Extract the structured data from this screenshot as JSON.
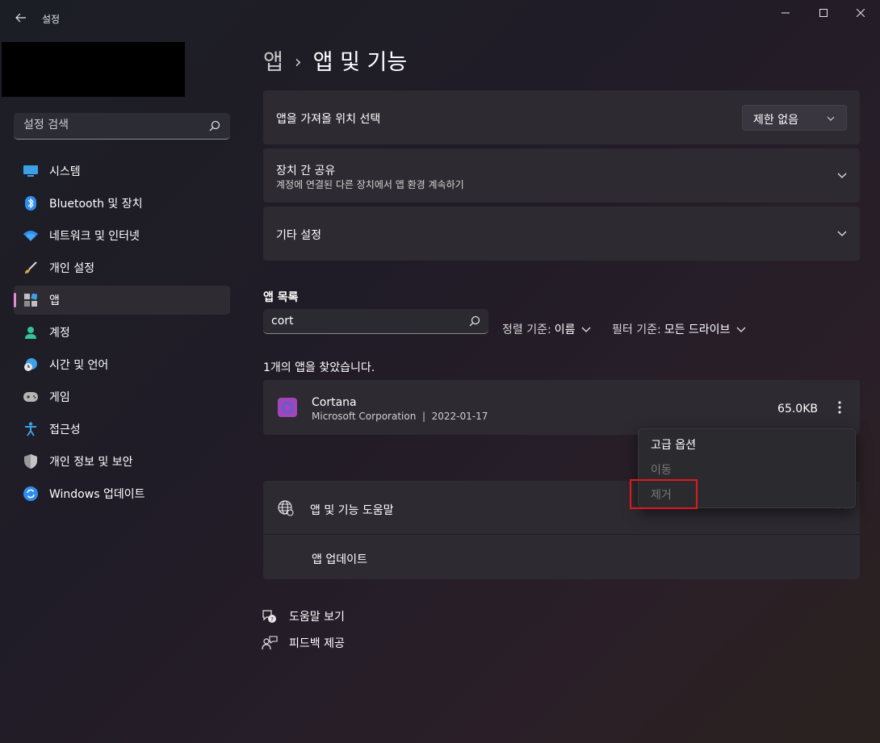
{
  "window": {
    "title": "설정",
    "minimize_icon": "minimize-icon",
    "maximize_icon": "maximize-icon",
    "close_icon": "close-icon"
  },
  "sidebar": {
    "search_placeholder": "설정 검색",
    "items": [
      {
        "label": "시스템",
        "icon": "system-icon"
      },
      {
        "label": "Bluetooth 및 장치",
        "icon": "bluetooth-icon"
      },
      {
        "label": "네트워크 및 인터넷",
        "icon": "wifi-icon"
      },
      {
        "label": "개인 설정",
        "icon": "brush-icon"
      },
      {
        "label": "앱",
        "icon": "apps-icon",
        "active": true
      },
      {
        "label": "계정",
        "icon": "account-icon"
      },
      {
        "label": "시간 및 언어",
        "icon": "clock-globe-icon"
      },
      {
        "label": "게임",
        "icon": "gamepad-icon"
      },
      {
        "label": "접근성",
        "icon": "accessibility-icon"
      },
      {
        "label": "개인 정보 및 보안",
        "icon": "shield-icon"
      },
      {
        "label": "Windows 업데이트",
        "icon": "update-icon"
      }
    ]
  },
  "breadcrumb": {
    "parent": "앱",
    "separator": "›",
    "current": "앱 및 기능"
  },
  "settings": {
    "install_source": {
      "label": "앱을 가져올 위치 선택",
      "value": "제한 없음"
    },
    "share_across": {
      "label": "장치 간 공유",
      "sub": "계정에 연결된 다른 장치에서 앱 환경 계속하기"
    },
    "more_settings": {
      "label": "기타 설정"
    }
  },
  "app_list": {
    "heading": "앱 목록",
    "search_value": "cort",
    "sort_label": "정렬 기준:",
    "sort_value": "이름",
    "filter_label": "필터 기준:",
    "filter_value": "모든 드라이브",
    "found_text": "1개의 앱을 찾았습니다.",
    "apps": [
      {
        "name": "Cortana",
        "publisher": "Microsoft Corporation",
        "separator": "|",
        "date": "2022-01-17",
        "size": "65.0KB"
      }
    ]
  },
  "context_menu": {
    "items": [
      {
        "label": "고급 옵션",
        "enabled": true
      },
      {
        "label": "이동",
        "enabled": false
      },
      {
        "label": "제거",
        "enabled": false
      }
    ],
    "highlight_color": "#e0191e"
  },
  "help": {
    "title": "앱 및 기능 도움말",
    "link": "앱 업데이트"
  },
  "footer": {
    "get_help": "도움말 보기",
    "feedback": "피드백 제공"
  },
  "colors": {
    "accent": "#e58bd6",
    "card_bg": "#2e2a31"
  }
}
